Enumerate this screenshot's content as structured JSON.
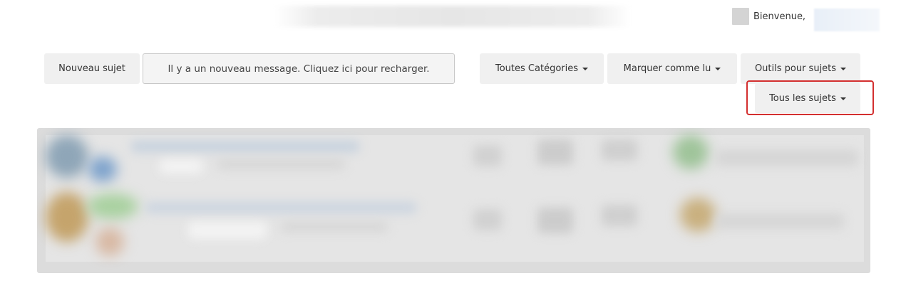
{
  "header": {
    "welcome_text": "Bienvenue,"
  },
  "toolbar": {
    "new_topic_label": "Nouveau sujet",
    "reload_notice": "Il y a un nouveau message. Cliquez ici pour recharger.",
    "categories_label": "Toutes Catégories",
    "mark_read_label": "Marquer comme lu",
    "topic_tools_label": "Outils pour sujets",
    "all_topics_label": "Tous les sujets"
  },
  "colors": {
    "highlight": "#d32f2f",
    "button_bg": "#f0f0f0"
  }
}
